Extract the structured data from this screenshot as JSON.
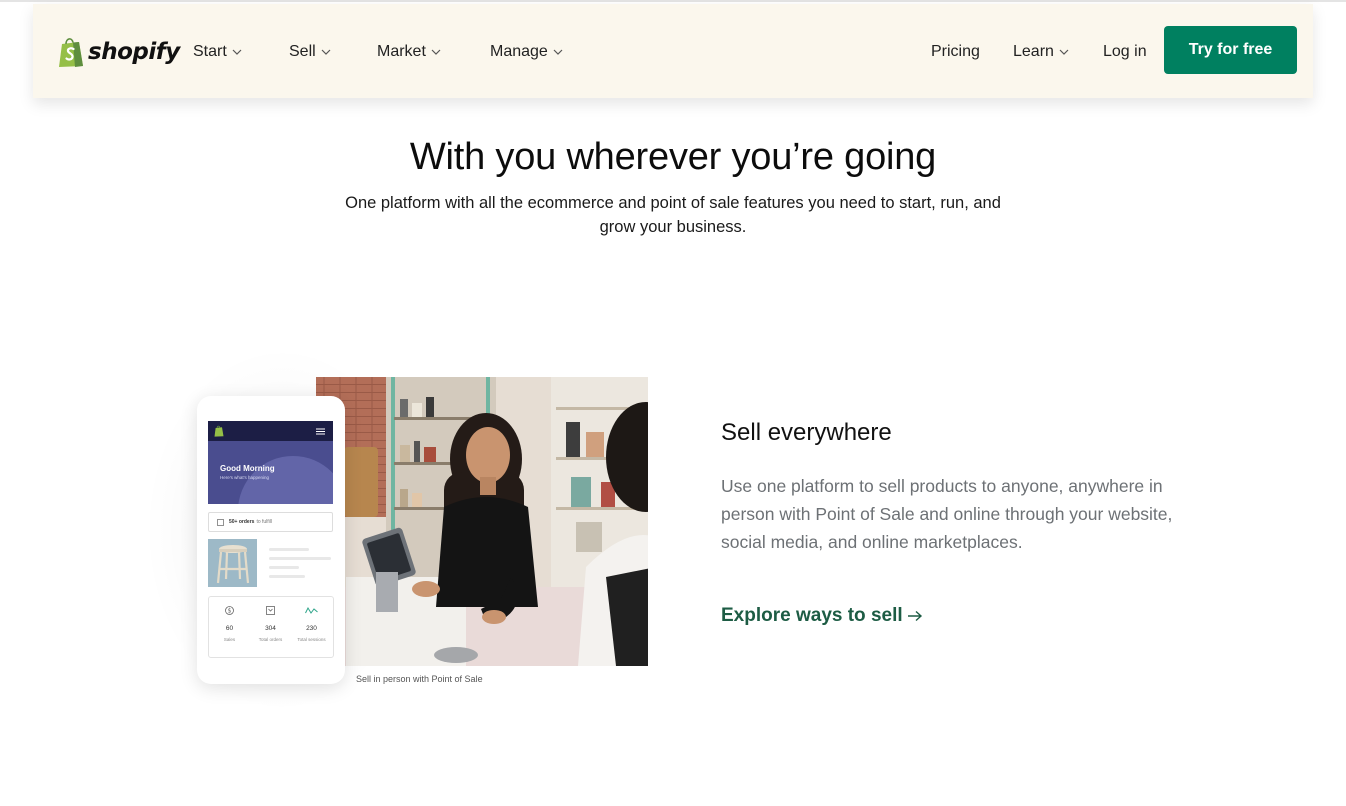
{
  "nav": {
    "logo_text": "shopify",
    "items": [
      {
        "label": "Start"
      },
      {
        "label": "Sell"
      },
      {
        "label": "Market"
      },
      {
        "label": "Manage"
      }
    ],
    "right_items": [
      {
        "label": "Pricing"
      },
      {
        "label": "Learn"
      },
      {
        "label": "Log in"
      }
    ],
    "cta_label": "Try for free",
    "brand_color": "#008060",
    "background": "#fbf7ed"
  },
  "hero": {
    "title": "With you wherever you’re going",
    "subtitle": "One platform with all the ecommerce and point of sale features you need to start, run, and grow your business."
  },
  "feature": {
    "title": "Sell everywhere",
    "description": "Use one platform to sell products to anyone, anywhere in person with Point of Sale and online through your website, social media, and online marketplaces.",
    "link_label": "Explore ways to sell",
    "link_color": "#1d5c44",
    "photo_caption": "Sell in person with Point of Sale",
    "phone": {
      "greeting": "Good Morning",
      "greeting_sub": "Here's what's happening",
      "orders_count": "50+ orders",
      "orders_suffix": "to fulfill",
      "stats": [
        {
          "value": "60",
          "label": "Sales",
          "icon": "dollar-icon"
        },
        {
          "value": "304",
          "label": "Total orders",
          "icon": "orders-icon"
        },
        {
          "value": "230",
          "label": "Total sessions",
          "icon": "sessions-icon"
        }
      ]
    }
  }
}
